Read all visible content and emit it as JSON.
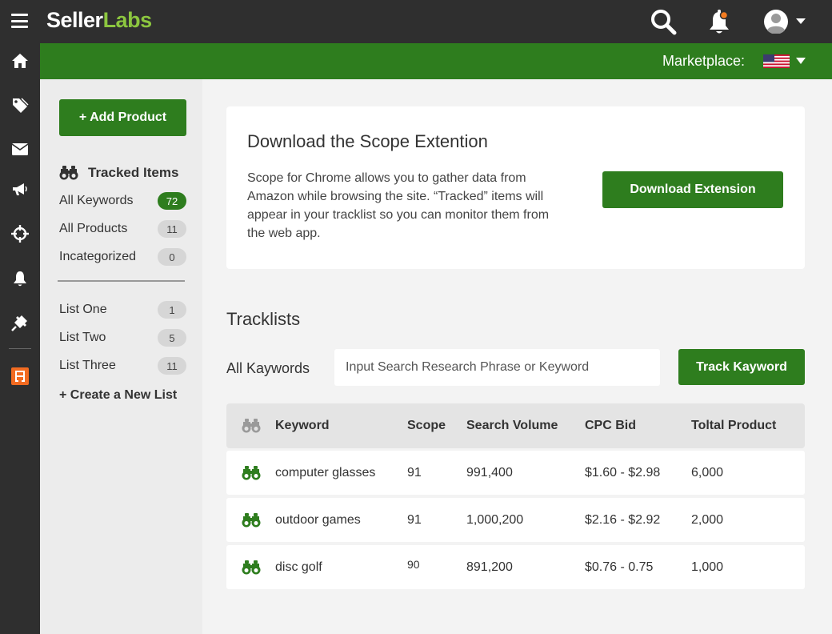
{
  "brand": {
    "name_part1": "Seller",
    "name_part2": "Labs",
    "accent": "#8cc63f",
    "primary_green": "#2e7d1e"
  },
  "topbar": {
    "icons": [
      "menu-icon",
      "search-icon",
      "notification-bell-icon",
      "user-avatar-icon",
      "caret-down-icon"
    ]
  },
  "marketplace": {
    "label": "Marketplace:",
    "flag": "us-flag-icon"
  },
  "rail": {
    "icons": [
      "home-icon",
      "tag-icon",
      "mail-icon",
      "megaphone-icon",
      "crosshair-icon",
      "bell-icon",
      "plugin-icon",
      "scope-app-icon"
    ]
  },
  "sidebar": {
    "add_product_label": "+ Add Product",
    "tracked_title": "Tracked Items",
    "tracked_items": [
      {
        "label": "All Keywords",
        "count": "72",
        "active": true
      },
      {
        "label": "All Products",
        "count": "11"
      },
      {
        "label": "Incategorized",
        "count": "0"
      }
    ],
    "lists": [
      {
        "label": "List One",
        "count": "1"
      },
      {
        "label": "List Two",
        "count": "5"
      },
      {
        "label": "List Three",
        "count": "11"
      }
    ],
    "create_list_label": "+ Create a New List"
  },
  "extension_card": {
    "title": "Download the Scope Extention",
    "text": "Scope for Chrome allows you to gather data from Amazon while browsing the site. “Tracked” items will appear in your tracklist so you can monitor them from the web app.",
    "button_label": "Download Extension"
  },
  "tracklists": {
    "title": "Tracklists",
    "filter_label": "All Kaywords",
    "input_placeholder": "Input Search Research Phrase or Keyword",
    "track_button_label": "Track Kayword",
    "columns": {
      "keyword": "Keyword",
      "scope": "Scope",
      "volume": "Search Volume",
      "cpc": "CPC Bid",
      "total": "Toltal Product"
    },
    "rows": [
      {
        "keyword": "computer glasses",
        "scope": "91",
        "volume": "991,400",
        "cpc": "$1.60 - $2.98",
        "total": "6,000"
      },
      {
        "keyword": "outdoor games",
        "scope": "91",
        "volume": "1,000,200",
        "cpc": "$2.16 - $2.92",
        "total": "2,000"
      },
      {
        "keyword": "disc golf",
        "scope": "90",
        "volume": "891,200",
        "cpc": "$0.76 - 0.75",
        "total": "1,000"
      }
    ]
  }
}
